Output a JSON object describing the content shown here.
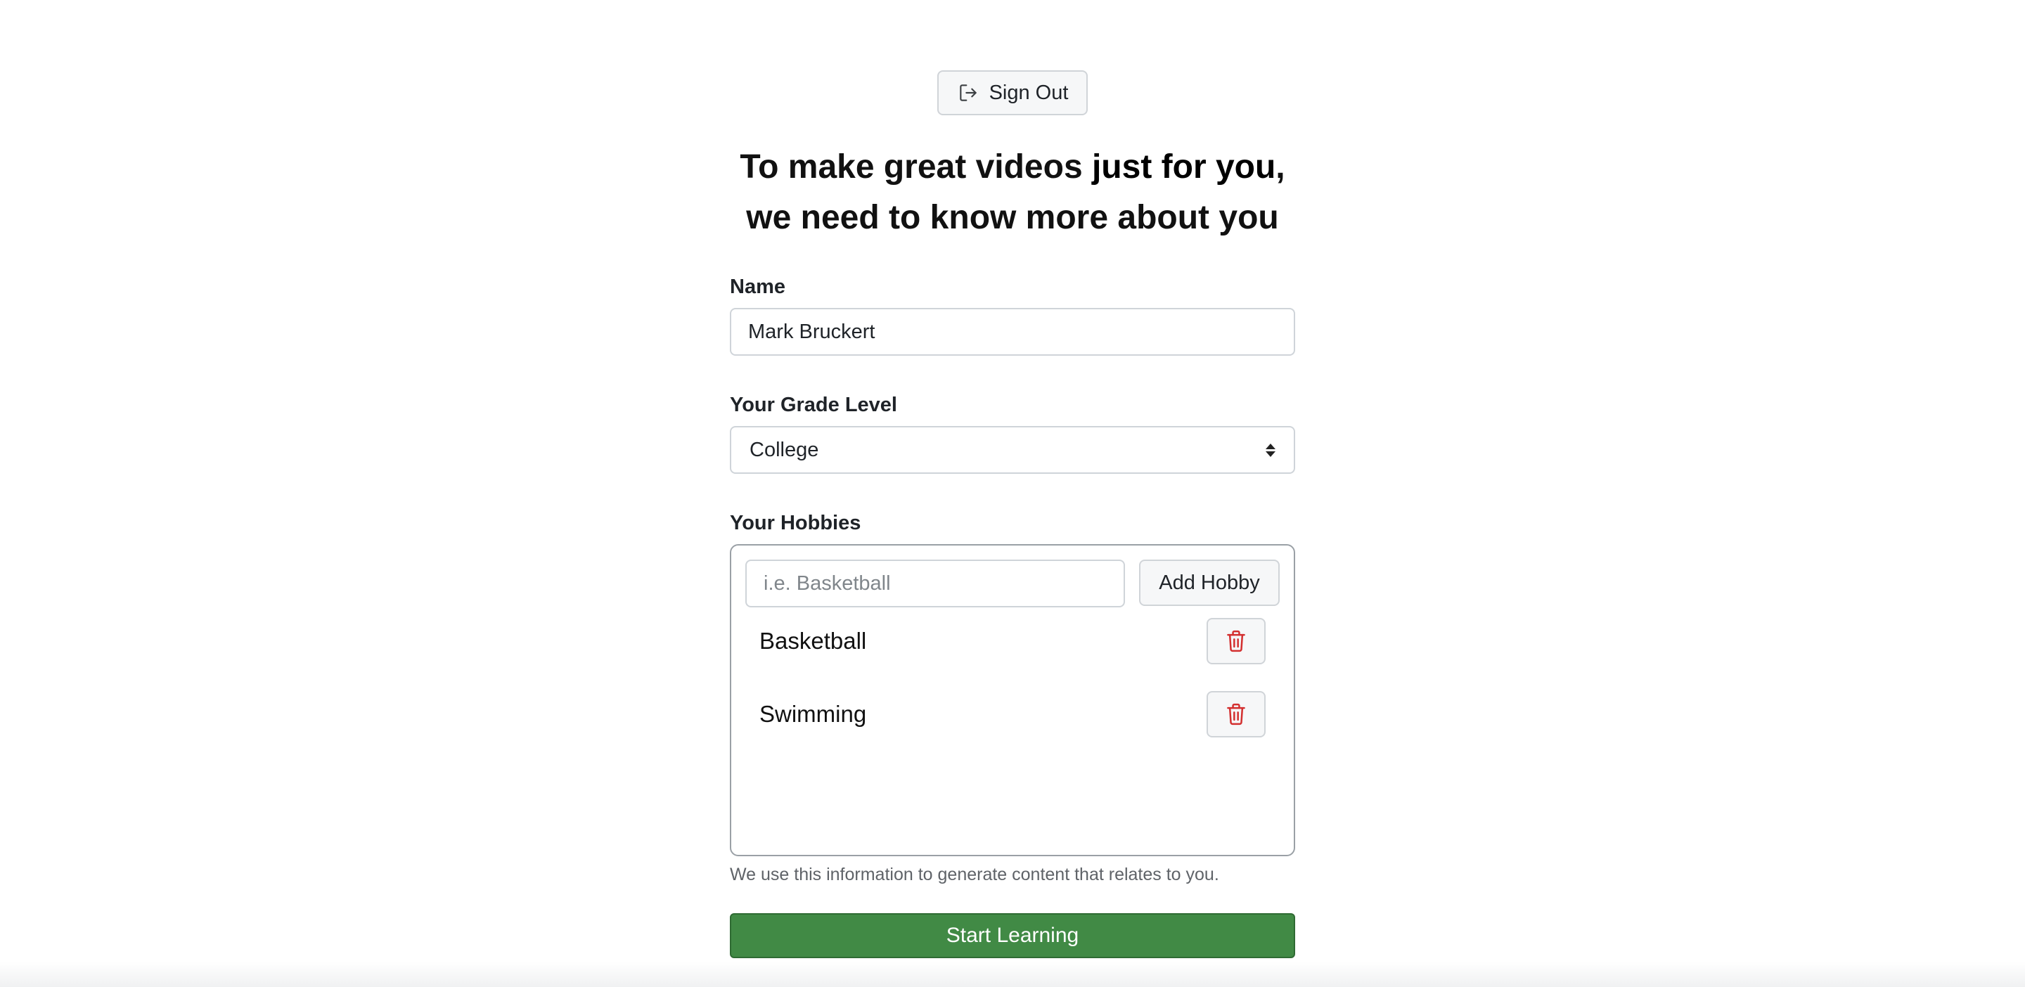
{
  "header": {
    "sign_out_label": "Sign Out",
    "sign_out_icon": "sign-out-icon"
  },
  "headline": {
    "line1_start": "To make great videos ",
    "line1_emphasis": "just for you",
    "line1_end": ",",
    "line2": "we need to know more about you"
  },
  "form": {
    "name_label": "Name",
    "name_value": "Mark Bruckert",
    "grade_label": "Your Grade Level",
    "grade_value": "College",
    "hobbies_label": "Your Hobbies",
    "hobby_placeholder": "i.e. Basketball",
    "add_hobby_label": "Add Hobby",
    "hobbies": [
      {
        "name": "Basketball"
      },
      {
        "name": "Swimming"
      }
    ],
    "helper_text": "We use this information to generate content that relates to you.",
    "submit_label": "Start Learning"
  },
  "colors": {
    "primary_button": "#418a45",
    "delete_icon": "#d32f2f"
  }
}
